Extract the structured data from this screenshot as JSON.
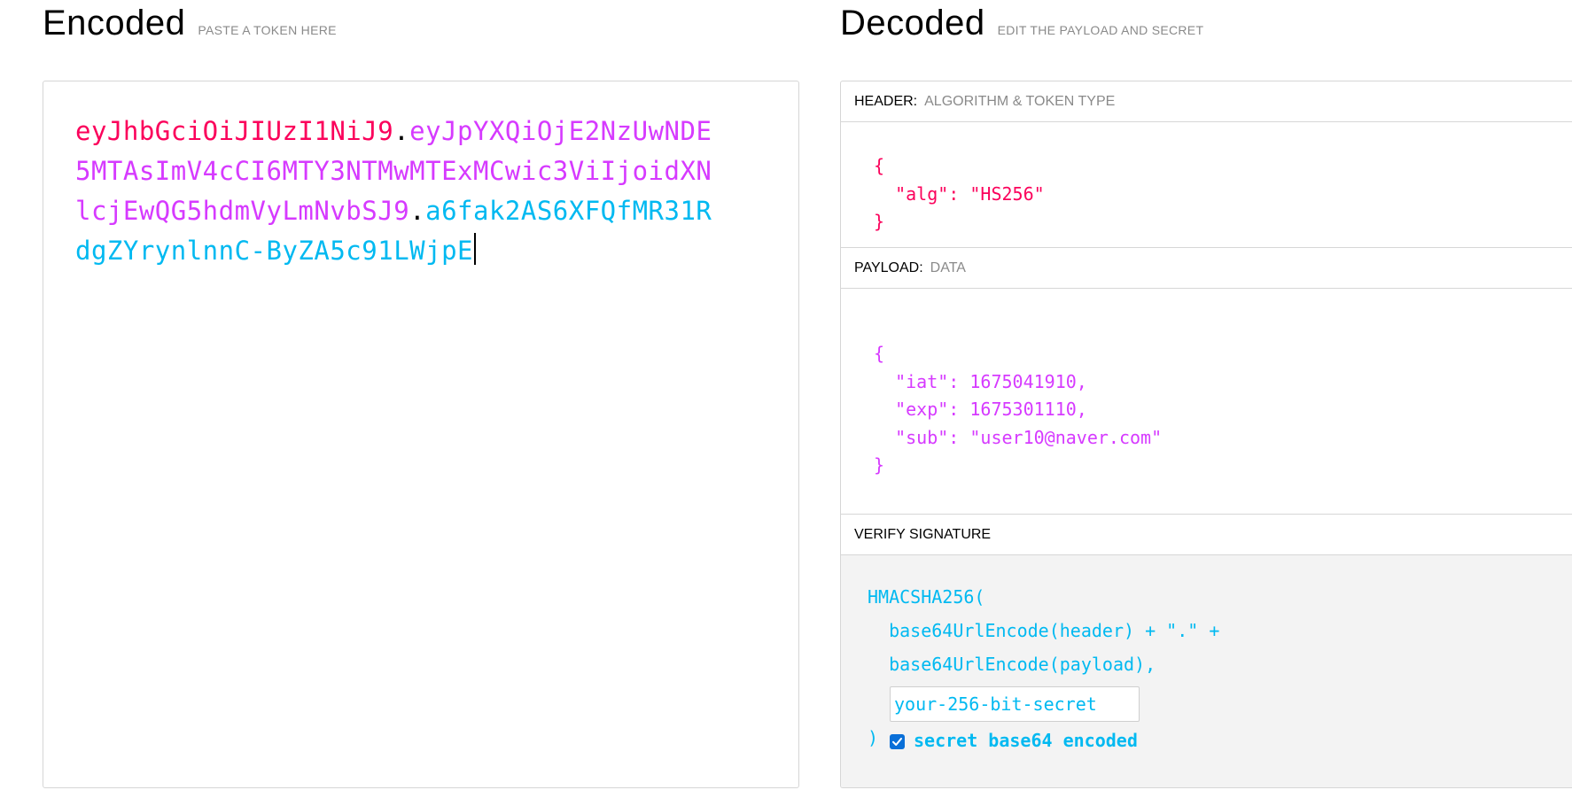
{
  "encoded": {
    "title": "Encoded",
    "subtitle": "PASTE A TOKEN HERE",
    "token": {
      "header": "eyJhbGciOiJIUzI1NiJ9",
      "payload": "eyJpYXQiOjE2NzUwNDE5MTAsImV4cCI6MTY3NTMwMTExMCwic3ViIjoidXNlcjEwQG5hdmVyLmNvbSJ9",
      "signature": "a6fak2AS6XFQfMR31RdgZYrynlnnC-ByZA5c91LWjpE",
      "dot": "."
    }
  },
  "decoded": {
    "title": "Decoded",
    "subtitle": "EDIT THE PAYLOAD AND SECRET",
    "header_section": {
      "label": "HEADER:",
      "sub": "ALGORITHM & TOKEN TYPE",
      "json": "{\n  \"alg\": \"HS256\"\n}"
    },
    "payload_section": {
      "label": "PAYLOAD:",
      "sub": "DATA",
      "json": "{\n  \"iat\": 1675041910,\n  \"exp\": 1675301110,\n  \"sub\": \"user10@naver.com\"\n}"
    },
    "verify_section": {
      "label": "VERIFY SIGNATURE",
      "line1": "HMACSHA256(",
      "line2": "  base64UrlEncode(header) + \".\" +",
      "line3": "  base64UrlEncode(payload),",
      "secret_placeholder": "your-256-bit-secret",
      "close_paren": ")",
      "checkbox_label": "secret base64 encoded",
      "checkbox_checked": true
    }
  },
  "colors": {
    "header": "#fb015b",
    "payload": "#d63aff",
    "signature": "#00b9f1"
  }
}
